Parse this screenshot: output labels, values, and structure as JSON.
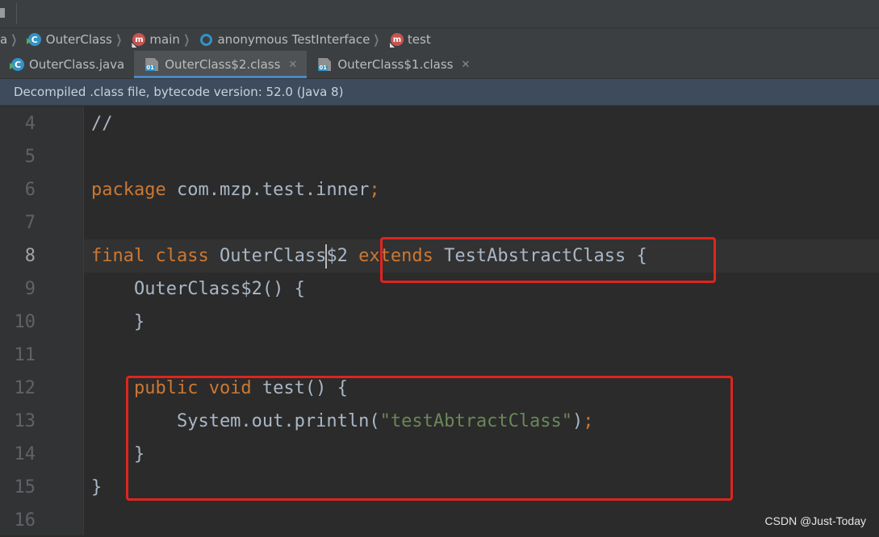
{
  "breadcrumb": {
    "items": [
      {
        "label": "a",
        "icon": "none"
      },
      {
        "label": "OuterClass",
        "icon": "class-icon"
      },
      {
        "label": "main",
        "icon": "method-icon"
      },
      {
        "label": "anonymous TestInterface",
        "icon": "anonymous-class-icon"
      },
      {
        "label": "test",
        "icon": "method-icon"
      }
    ]
  },
  "tabs": [
    {
      "label": "OuterClass.java",
      "icon": "class-icon",
      "active": false,
      "closable": false
    },
    {
      "label": "OuterClass$2.class",
      "icon": "compiled-class-icon",
      "active": true,
      "closable": true
    },
    {
      "label": "OuterClass$1.class",
      "icon": "compiled-class-icon",
      "active": false,
      "closable": true
    }
  ],
  "banner": {
    "text": "Decompiled .class file, bytecode version: 52.0 (Java 8)"
  },
  "editor": {
    "current_line": "8",
    "lines": [
      {
        "num": "4",
        "tokens": [
          {
            "t": "//",
            "c": "plain"
          }
        ]
      },
      {
        "num": "5",
        "tokens": []
      },
      {
        "num": "6",
        "tokens": [
          {
            "t": "package",
            "c": "kw"
          },
          {
            "t": " com.mzp.test.inner",
            "c": "plain"
          },
          {
            "t": ";",
            "c": "kw"
          }
        ]
      },
      {
        "num": "7",
        "tokens": []
      },
      {
        "num": "8",
        "tokens": [
          {
            "t": "final class",
            "c": "kw"
          },
          {
            "t": " OuterClass",
            "c": "plain"
          },
          {
            "t": "$2 ",
            "c": "plain"
          },
          {
            "t": "extends",
            "c": "kw"
          },
          {
            "t": " TestAbstractClass {",
            "c": "plain"
          }
        ]
      },
      {
        "num": "9",
        "tokens": [
          {
            "t": "    OuterClass$2() {",
            "c": "plain"
          }
        ]
      },
      {
        "num": "10",
        "tokens": [
          {
            "t": "    }",
            "c": "plain"
          }
        ]
      },
      {
        "num": "11",
        "tokens": []
      },
      {
        "num": "12",
        "tokens": [
          {
            "t": "    ",
            "c": "plain"
          },
          {
            "t": "public void",
            "c": "kw"
          },
          {
            "t": " test() {",
            "c": "plain"
          }
        ]
      },
      {
        "num": "13",
        "tokens": [
          {
            "t": "        System.out.println(",
            "c": "plain"
          },
          {
            "t": "\"testAbtractClass\"",
            "c": "str"
          },
          {
            "t": ")",
            "c": "plain"
          },
          {
            "t": ";",
            "c": "kw"
          }
        ]
      },
      {
        "num": "14",
        "tokens": [
          {
            "t": "    }",
            "c": "plain"
          }
        ]
      },
      {
        "num": "15",
        "tokens": [
          {
            "t": "}",
            "c": "plain"
          }
        ]
      },
      {
        "num": "16",
        "tokens": []
      }
    ]
  },
  "watermark": "CSDN @Just-Today",
  "colors": {
    "keyword": "#cc7832",
    "string": "#6a8759",
    "identifier": "#a9b7c6",
    "highlight_box": "#e0241e",
    "banner_bg": "#3d4b5c"
  }
}
